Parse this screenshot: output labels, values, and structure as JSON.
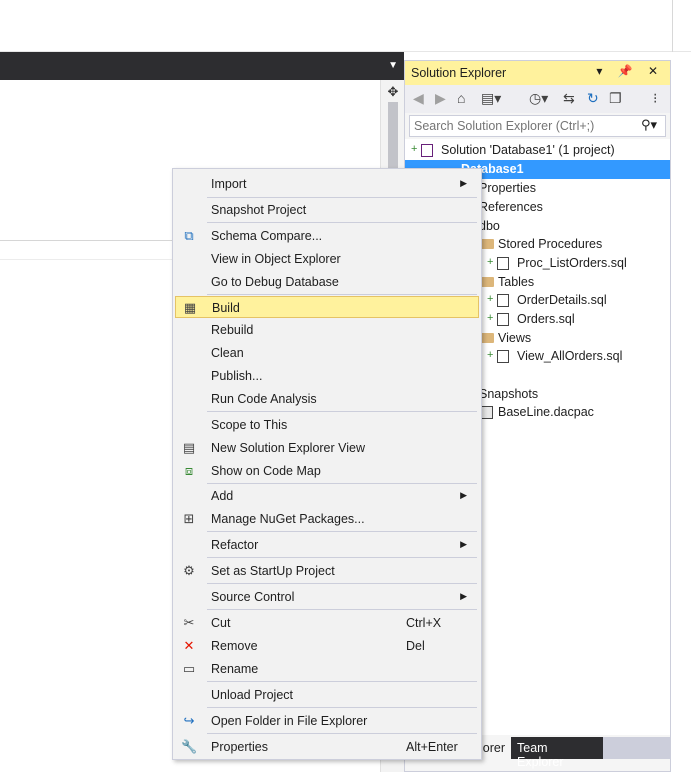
{
  "solution_explorer": {
    "title": "Solution Explorer",
    "title_buttons": "▾ 📌 ✕",
    "search_placeholder": "Search Solution Explorer (Ctrl+;)",
    "tree": {
      "solution": "Solution 'Database1' (1 project)",
      "project": "Database1",
      "properties": "Properties",
      "references": "References",
      "dbo": "dbo",
      "stored_procedures": "Stored Procedures",
      "proc_listorders": "Proc_ListOrders.sql",
      "tables": "Tables",
      "orderdetails": "OrderDetails.sql",
      "orders": "Orders.sql",
      "views": "Views",
      "view_allorders": "View_AllOrders.sql",
      "snapshots": "Snapshots",
      "baseline": "BaseLine.dacpac"
    },
    "tabs": {
      "solution_explorer_tab": "lorer",
      "team_explorer_tab": "Team Explorer"
    }
  },
  "context_menu": {
    "import": "Import",
    "snapshot_project": "Snapshot Project",
    "schema_compare": "Schema Compare...",
    "view_in_object_explorer": "View in Object Explorer",
    "go_to_debug_database": "Go to Debug Database",
    "build": "Build",
    "rebuild": "Rebuild",
    "clean": "Clean",
    "publish": "Publish...",
    "run_code_analysis": "Run Code Analysis",
    "scope_to_this": "Scope to This",
    "new_solution_explorer_view": "New Solution Explorer View",
    "show_on_code_map": "Show on Code Map",
    "add": "Add",
    "manage_nuget_packages": "Manage NuGet Packages...",
    "refactor": "Refactor",
    "set_as_startup_project": "Set as StartUp Project",
    "source_control": "Source Control",
    "cut": "Cut",
    "cut_shortcut": "Ctrl+X",
    "remove": "Remove",
    "remove_shortcut": "Del",
    "rename": "Rename",
    "unload_project": "Unload Project",
    "open_folder_in_file_explorer": "Open Folder in File Explorer",
    "properties": "Properties",
    "properties_shortcut": "Alt+Enter"
  },
  "colors": {
    "accent_highlight": "#fff29d",
    "selection": "#3399ff",
    "chrome_dark": "#2d2d30"
  }
}
